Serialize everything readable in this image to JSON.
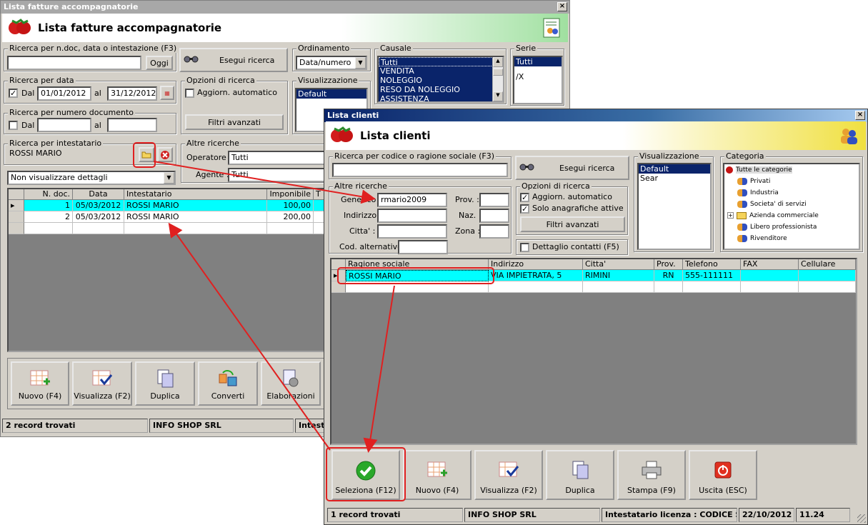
{
  "invoice_window": {
    "title": "Lista fatture accompagnatorie",
    "header": "Lista fatture accompagnatorie",
    "search_doc": {
      "label": "Ricerca per n.doc, data o intestazione (F3)",
      "value": "",
      "button": "Oggi"
    },
    "run_search_button": "Esegui ricerca",
    "ordering": {
      "label": "Ordinamento",
      "value": "Data/numero"
    },
    "causale": {
      "label": "Causale",
      "items": [
        "Tutti",
        "VENDITA",
        "NOLEGGIO",
        "RESO DA NOLEGGIO",
        "ASSISTENZA"
      ]
    },
    "serie": {
      "label": "Serie",
      "items": [
        "Tutti",
        "/X"
      ]
    },
    "date_search": {
      "label": "Ricerca per data",
      "from_label": "Dal",
      "from_value": "01/01/2012",
      "to_label": "al",
      "to_value": "31/12/2012",
      "checked": true
    },
    "options": {
      "label": "Opzioni di ricerca",
      "auto_update": "Aggiorn. automatico",
      "filters_button": "Filtri avanzati"
    },
    "view": {
      "label": "Visualizzazione",
      "items": [
        "Default"
      ]
    },
    "number_search": {
      "label": "Ricerca per numero documento",
      "from_label": "Dal",
      "to_label": "al"
    },
    "holder_search": {
      "label": "Ricerca per intestatario",
      "value": "ROSSI MARIO"
    },
    "other_search": {
      "label": "Altre ricerche",
      "operator_label": "Operatore :",
      "operator_value": "Tutti",
      "agent_label": "Agente :",
      "agent_value": "Tutti"
    },
    "details_select": "Non visualizzare dettagli",
    "grid": {
      "columns": [
        "N. doc.",
        "Data",
        "Intestatario",
        "Imponibile",
        "T"
      ],
      "rows": [
        {
          "num": "1",
          "date": "05/03/2012",
          "holder": "ROSSI MARIO",
          "amount": "100,00"
        },
        {
          "num": "2",
          "date": "05/03/2012",
          "holder": "ROSSI MARIO",
          "amount": "200,00"
        }
      ]
    },
    "toolbar": [
      "Nuovo (F4)",
      "Visualizza (F2)",
      "Duplica",
      "Converti",
      "Elaborazioni"
    ],
    "status": {
      "records": "2 record trovati",
      "company": "INFO SHOP SRL",
      "license": "Intestatario licenza"
    }
  },
  "clients_window": {
    "title": "Lista clienti",
    "header": "Lista clienti",
    "search": {
      "label": "Ricerca per codice o ragione sociale (F3)",
      "value": ""
    },
    "run_search_button": "Esegui ricerca",
    "view": {
      "label": "Visualizzazione",
      "items": [
        "Default",
        "Sear"
      ]
    },
    "category": {
      "label": "Categoria",
      "items": [
        "Tutte le categorie",
        "Privati",
        "Industria",
        "Societa' di servizi",
        "Azienda commerciale",
        "Libero professionista",
        "Rivenditore"
      ]
    },
    "other_search": {
      "label": "Altre ricerche",
      "generic_label": "Generico :",
      "generic_value": "rmario2009",
      "address_label": "Indirizzo :",
      "city_label": "Citta' :",
      "alt_code_label": "Cod. alternativo :",
      "prov_label": "Prov. :",
      "nation_label": "Naz. :",
      "zone_label": "Zona :"
    },
    "options": {
      "label": "Opzioni di ricerca",
      "auto_update": "Aggiorn. automatico",
      "active_only": "Solo anagrafiche attive",
      "filters_button": "Filtri avanzati"
    },
    "contact_detail": "Dettaglio contatti (F5)",
    "grid": {
      "columns": [
        "Ragione sociale",
        "Indirizzo",
        "Citta'",
        "Prov.",
        "Telefono",
        "FAX",
        "Cellulare"
      ],
      "rows": [
        {
          "name": "ROSSI MARIO",
          "address": "VIA IMPIETRATA, 5",
          "city": "RIMINI",
          "prov": "RN",
          "phone": "555-111111",
          "fax": "",
          "mobile": ""
        }
      ]
    },
    "toolbar": [
      "Seleziona (F12)",
      "Nuovo (F4)",
      "Visualizza (F2)",
      "Duplica",
      "Stampa (F9)",
      "Uscita (ESC)"
    ],
    "status": {
      "records": "1 record trovati",
      "company": "INFO SHOP SRL",
      "license": "Intestatario licenza : CODICE SF",
      "date": "22/10/2012",
      "time": "11.24"
    }
  },
  "colors": {
    "highlight": "#00ffff",
    "annotation": "#e02020",
    "selection": "#0a246a"
  }
}
